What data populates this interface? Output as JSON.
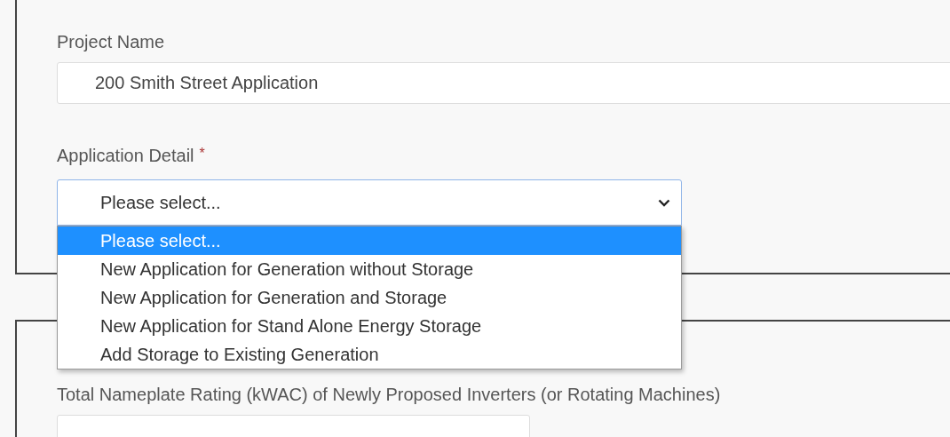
{
  "project_name": {
    "label": "Project Name",
    "value": "200 Smith Street Application"
  },
  "application_detail": {
    "label": "Application Detail",
    "required_mark": "*",
    "value": "Please select...",
    "expanded": true,
    "options": [
      {
        "label": "Please select...",
        "selected": true
      },
      {
        "label": "New Application for Generation without Storage",
        "selected": false
      },
      {
        "label": "New Application for Generation and Storage",
        "selected": false
      },
      {
        "label": "New Application for Stand Alone Energy Storage",
        "selected": false
      },
      {
        "label": "Add Storage to Existing Generation",
        "selected": false
      }
    ]
  },
  "nameplate_rating": {
    "label": "Total Nameplate Rating (kWAC) of Newly Proposed Inverters (or Rotating Machines)"
  }
}
